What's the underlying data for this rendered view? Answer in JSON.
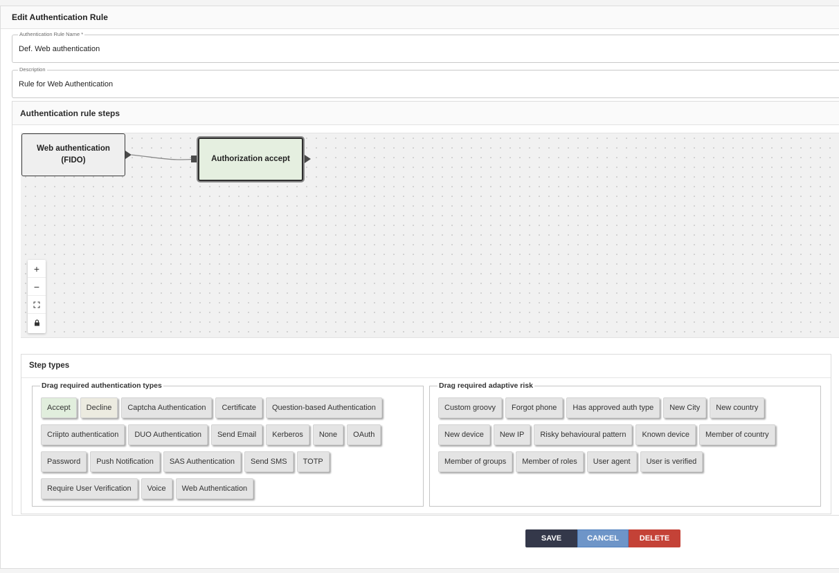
{
  "header": {
    "title": "Edit Authentication Rule"
  },
  "fields": {
    "name": {
      "label": "Authentication Rule Name *",
      "value": "Def. Web authentication"
    },
    "description": {
      "label": "Description",
      "value": "Rule for Web Authentication"
    }
  },
  "steps": {
    "title": "Authentication rule steps",
    "nodes": {
      "webauth": {
        "label": "Web authentication (FIDO)"
      },
      "accept": {
        "label": "Authorization accept"
      }
    },
    "zoom": {
      "zoom_in": "+",
      "zoom_out": "−",
      "fit_icon": "fit-view-icon",
      "lock_icon": "lock-icon"
    }
  },
  "step_types": {
    "title": "Step types",
    "auth_group": {
      "legend": "Drag required authentication types",
      "items": [
        "Accept",
        "Decline",
        "Captcha Authentication",
        "Certificate",
        "Question-based Authentication",
        "Criipto authentication",
        "DUO Authentication",
        "Send Email",
        "Kerberos",
        "None",
        "OAuth",
        "Password",
        "Push Notification",
        "SAS Authentication",
        "Send SMS",
        "TOTP",
        "Require User Verification",
        "Voice",
        "Web Authentication"
      ]
    },
    "risk_group": {
      "legend": "Drag required adaptive risk",
      "items": [
        "Custom groovy",
        "Forgot phone",
        "Has approved auth type",
        "New City",
        "New country",
        "New device",
        "New IP",
        "Risky behavioural pattern",
        "Known device",
        "Member of country",
        "Member of groups",
        "Member of roles",
        "User agent",
        "User is verified"
      ]
    }
  },
  "actions": {
    "save": "SAVE",
    "cancel": "CANCEL",
    "delete": "DELETE"
  },
  "colors": {
    "accept_chip": "#e1eedd",
    "decline_chip": "#ecebe0",
    "save_button": "#34384a",
    "cancel_button": "#6e95c8",
    "delete_button": "#c44237",
    "accept_node": "#e5efe0"
  }
}
